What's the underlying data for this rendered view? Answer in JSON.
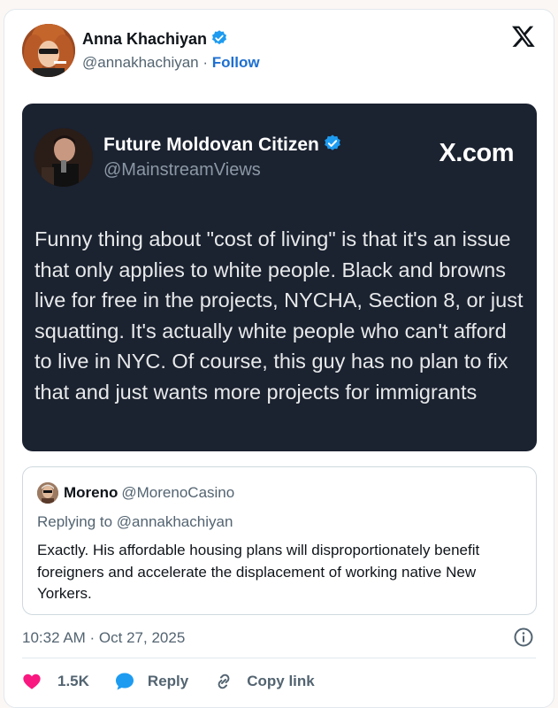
{
  "author": {
    "name": "Anna Khachiyan",
    "handle": "@annakhachiyan",
    "separator": "·",
    "follow_label": "Follow"
  },
  "quoted_post": {
    "author_name": "Future Moldovan Citizen",
    "author_handle": "@MainstreamViews",
    "source_logo": "X.com",
    "text": "Funny thing about \"cost of living\" is that it's an issue that only applies to white people. Black and browns live for free in the projects, NYCHA, Section 8, or just squatting. It's actually white people who can't afford to live in NYC. Of course, this guy has no plan to fix that and just wants more projects for immigrants"
  },
  "reply": {
    "author_name": "Moreno",
    "author_handle": "@MorenoCasino",
    "replying_to": "Replying to @annakhachiyan",
    "text": "Exactly. His affordable housing plans will disproportionately benefit foreigners and accelerate the displacement of working native New Yorkers."
  },
  "timestamp": "10:32 AM · Oct 27, 2025",
  "actions": {
    "like_count": "1.5K",
    "reply_label": "Reply",
    "copy_link_label": "Copy link"
  },
  "colors": {
    "link_blue": "#1d6fd1",
    "verified_blue": "#1d9bf0",
    "heart_pink": "#f91880",
    "embed_background": "#1b2230"
  },
  "icons": {
    "verified": "verified-badge-icon",
    "x_logo": "x-logo-icon",
    "info": "info-icon",
    "like": "heart-icon",
    "reply": "speech-bubble-icon",
    "copy_link": "link-icon"
  }
}
